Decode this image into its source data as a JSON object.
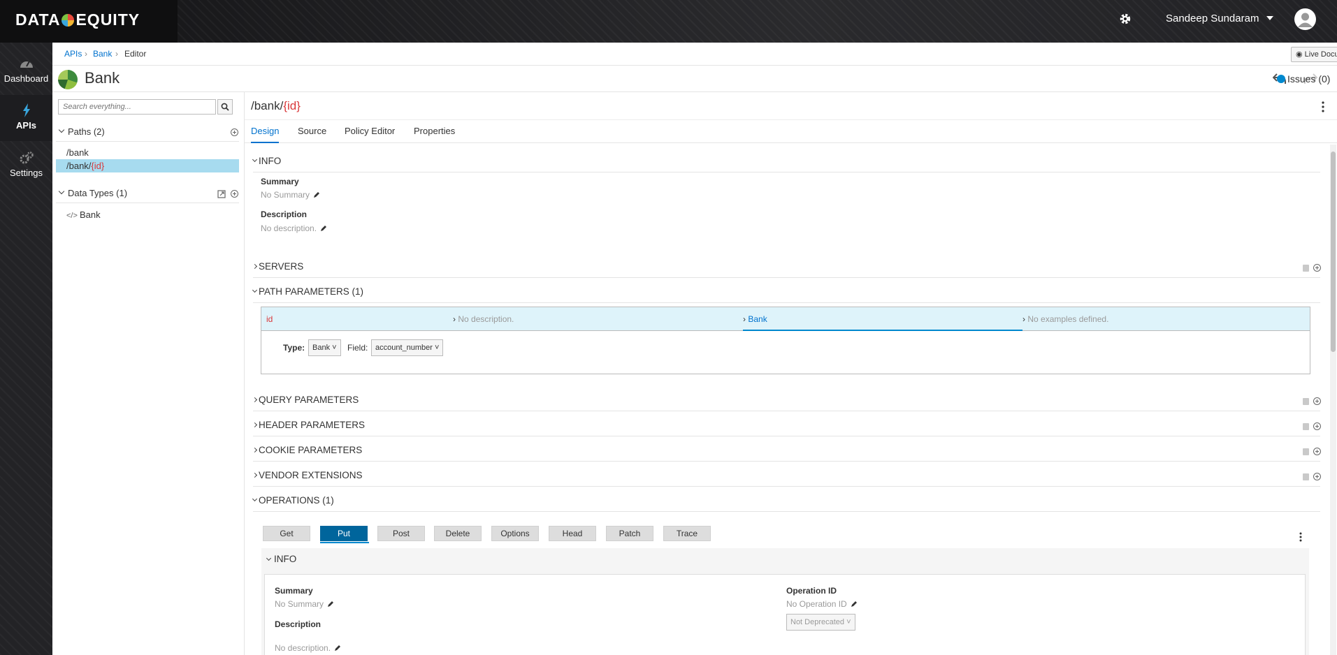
{
  "header": {
    "logo_text_left": "DATA",
    "logo_text_right": "EQUITY",
    "user_name": "Sandeep Sundaram"
  },
  "nav": {
    "items": [
      {
        "label": "Dashboard",
        "icon": "dashboard-icon"
      },
      {
        "label": "APIs",
        "icon": "bolt-icon",
        "active": true
      },
      {
        "label": "Settings",
        "icon": "gears-icon"
      }
    ]
  },
  "breadcrumb": {
    "items": [
      "APIs",
      "Bank",
      "Editor"
    ],
    "live_doc_label": "Live Documentation"
  },
  "api": {
    "title": "Bank",
    "issues_label": "Issues (0)"
  },
  "left_panel": {
    "search_placeholder": "Search everything...",
    "paths_title": "Paths (2)",
    "paths": [
      {
        "prefix": "/bank",
        "param": ""
      },
      {
        "prefix": "/bank/",
        "param": "{id}",
        "selected": true
      }
    ],
    "types_title": "Data Types (1)",
    "types": [
      "Bank"
    ]
  },
  "main": {
    "path_prefix": "/bank/",
    "path_param": "{id}",
    "tabs": [
      "Design",
      "Source",
      "Policy Editor",
      "Properties"
    ],
    "active_tab": "Design",
    "info": {
      "title": "INFO",
      "summary_label": "Summary",
      "summary_value": "No Summary",
      "description_label": "Description",
      "description_value": "No description."
    },
    "servers_title": "SERVERS",
    "path_params": {
      "title": "PATH PARAMETERS (1)",
      "name": "id",
      "description": "No description.",
      "type_link": "Bank",
      "examples": "No examples defined.",
      "type_label": "Type:",
      "type_value": "Bank",
      "field_label": "Field:",
      "field_value": "account_number"
    },
    "query_title": "QUERY PARAMETERS",
    "header_title": "HEADER PARAMETERS",
    "cookie_title": "COOKIE PARAMETERS",
    "vendor_title": "VENDOR EXTENSIONS",
    "operations": {
      "title": "OPERATIONS (1)",
      "methods": [
        "Get",
        "Put",
        "Post",
        "Delete",
        "Options",
        "Head",
        "Patch",
        "Trace"
      ],
      "active_method": "Put",
      "info_title": "INFO",
      "summary_label": "Summary",
      "summary_value": "No Summary",
      "operation_id_label": "Operation ID",
      "operation_id_value": "No Operation ID",
      "description_label": "Description",
      "description_value": "No description.",
      "deprecated_value": "Not Deprecated"
    }
  },
  "colors": {
    "accent": "#0072ce",
    "active_method": "#00659c",
    "path_param": "#d9383a",
    "selected_row": "#a7dbef",
    "param_row": "#def3fa"
  }
}
